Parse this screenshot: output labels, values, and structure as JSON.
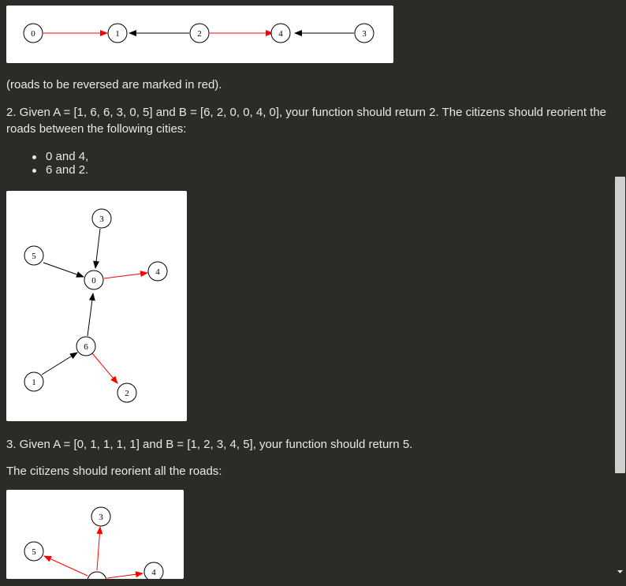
{
  "text": {
    "caption": "(roads to be reversed are marked in red).",
    "example2": "2. Given A = [1, 6, 6, 3, 0, 5] and B = [6, 2, 0, 0, 4, 0], your function should return 2. The citizens should reorient the roads between the following cities:",
    "example2_items": [
      "0 and 4,",
      "6 and 2."
    ],
    "example3": "3. Given A = [0, 1, 1, 1, 1] and B = [1, 2, 3, 4, 5], your function should return 5.",
    "example3_note": "The citizens should reorient all the roads:"
  },
  "figures": {
    "fig1_nodes": [
      "0",
      "1",
      "2",
      "4",
      "3"
    ],
    "fig2_nodes": [
      "3",
      "5",
      "0",
      "4",
      "6",
      "1",
      "2"
    ],
    "fig3_nodes": [
      "3",
      "5",
      "4"
    ]
  },
  "colors": {
    "page_bg": "#2b2b27",
    "text": "#e8e8e8",
    "edge_reversed": "#ff0000",
    "edge_normal": "#000000",
    "scrollbar_thumb": "#cfcfcf"
  },
  "scrollbar": {
    "position": 0.4
  }
}
